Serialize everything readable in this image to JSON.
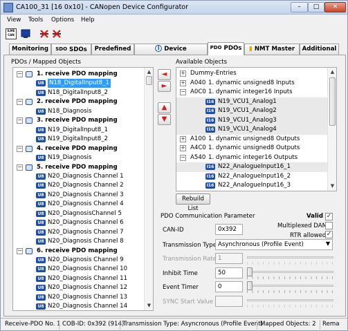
{
  "window": {
    "title": "CA100_31  [16  0x10]  - CANopen Device Configurator",
    "controls": {
      "minimize": "–",
      "maximize": "□",
      "close": "✕"
    }
  },
  "menu": {
    "view": "View",
    "tools": "Tools",
    "options": "Options",
    "help": "Help"
  },
  "toolbar": {
    "logo_text": "ILME\nCAN"
  },
  "tabs": [
    {
      "label": "Monitoring"
    },
    {
      "label": "SDOs",
      "icon_text": "SDO"
    },
    {
      "label": "Predefined"
    },
    {
      "label": "Device Information",
      "icon_text": "i"
    },
    {
      "label": "PDOs",
      "icon_text": "PDO"
    },
    {
      "label": "NMT Master"
    },
    {
      "label": "Additional"
    }
  ],
  "left": {
    "heading": "PDOs / Mapped Objects",
    "rows": [
      {
        "toggle": "−",
        "text": "1. receive PDO mapping",
        "bold": true
      },
      {
        "badge": "U8",
        "text": "N18_DigitalInput8_1",
        "selected": true
      },
      {
        "badge": "U8",
        "text": "N18_DigitalInput8_2"
      },
      {
        "toggle": "−",
        "text": "2. receive PDO mapping",
        "bold": true
      },
      {
        "badge": "U8",
        "text": "N18_Diagnosis"
      },
      {
        "toggle": "−",
        "text": "3. receive PDO mapping",
        "bold": true
      },
      {
        "badge": "U8",
        "text": "N19_DigitalInput8_1"
      },
      {
        "badge": "U8",
        "text": "N19_DigitalInput8_2"
      },
      {
        "toggle": "−",
        "text": "4. receive PDO mapping",
        "bold": true
      },
      {
        "badge": "U8",
        "text": "N19_Diagnosis"
      },
      {
        "toggle": "−",
        "text": "5. receive PDO mapping",
        "bold": true
      },
      {
        "badge": "U8",
        "text": "N20_Diagnosis Channel 1"
      },
      {
        "badge": "U8",
        "text": "N20_Diagnosis Channel 2"
      },
      {
        "badge": "U8",
        "text": "N20_Diagnosis Channel 3"
      },
      {
        "badge": "U8",
        "text": "N20_Diagnosis Channel 4"
      },
      {
        "badge": "U8",
        "text": "N20_DiagnosisChannel 5"
      },
      {
        "badge": "U8",
        "text": "N20_Diagnosis Channel 6"
      },
      {
        "badge": "U8",
        "text": "N20_Diagnosis Channel 7"
      },
      {
        "badge": "U8",
        "text": "N20_Diagnosis Channel 8"
      },
      {
        "toggle": "−",
        "text": "6. receive PDO mapping",
        "bold": true
      },
      {
        "badge": "U8",
        "text": "N20_Diagnosis Channel 9"
      },
      {
        "badge": "U8",
        "text": "N20_Diagnosis Channel 10"
      },
      {
        "badge": "U8",
        "text": "N20_Diagnosis Channel 11"
      },
      {
        "badge": "U8",
        "text": "N20_Diagnosis Channel 12"
      },
      {
        "badge": "U8",
        "text": "N20_Diagnosis Channel 13"
      },
      {
        "badge": "U8",
        "text": "N20_Diagnosis Channel 14"
      }
    ]
  },
  "middle_buttons": {
    "add": "◄",
    "remove": "►",
    "up": "▲",
    "down": "▼"
  },
  "right": {
    "heading": "Available Objects",
    "rows": [
      {
        "toggle": "+",
        "code": "",
        "text": "Dummy-Entries"
      },
      {
        "toggle": "+",
        "code": "A040",
        "text": "1. dynamic unsigned8 Inputs"
      },
      {
        "toggle": "−",
        "code": "A0C0",
        "text": "1. dynamic integer16 Inputs"
      },
      {
        "badge": "I16",
        "text": "N19_VCU1_Analog1",
        "shaded": true
      },
      {
        "badge": "I16",
        "text": "N19_VCU1_Analog2",
        "shaded": true
      },
      {
        "badge": "I16",
        "text": "N19_VCU1_Analog3",
        "shaded": true
      },
      {
        "badge": "I16",
        "text": "N19_VCU1_Analog4",
        "shaded": true
      },
      {
        "toggle": "+",
        "code": "A100",
        "text": "1. dynamic unsigned8 Outputs"
      },
      {
        "toggle": "+",
        "code": "A4C0",
        "text": "1. dynamic unsigned8 Outputs"
      },
      {
        "toggle": "−",
        "code": "A540",
        "text": "1. dynamic integer16 Outputs"
      },
      {
        "badge": "I16",
        "text": "N22_AnalogueInput16_1",
        "shaded": true
      },
      {
        "badge": "I16",
        "text": "N22_AnalogueInput16_2"
      },
      {
        "badge": "I16",
        "text": "N22_AnalogueInput16_3"
      }
    ],
    "rebuild_button": "Rebuild List"
  },
  "params": {
    "group_label": "PDO Communication Parameter",
    "valid_label": "Valid",
    "valid_checked": "✓",
    "multiplexed_label": "Multiplexed DAM",
    "rtr_label": "RTR allowed",
    "rtr_checked": "✓",
    "canid_label": "CAN-ID",
    "canid_value": "0x392",
    "transmission_type_label": "Transmission Type",
    "transmission_type_value": "Asynchronous (Profile Event)",
    "transmission_rate_label": "Transmission Rate",
    "transmission_rate_value": "1",
    "inhibit_label": "Inhibit Time",
    "inhibit_value": "50",
    "event_timer_label": "Event Timer",
    "event_timer_value": "0",
    "sync_label": "SYNC Start Value",
    "sync_value": ""
  },
  "statusbar": {
    "pdo": "Receive-PDO No. 1",
    "cobid": "COB-ID: 0x392 (914)",
    "ttype": "Transmission Type: Asyncronous (Profile Event)",
    "mapped": "Mapped Objects: 2",
    "rem": "Rema"
  }
}
